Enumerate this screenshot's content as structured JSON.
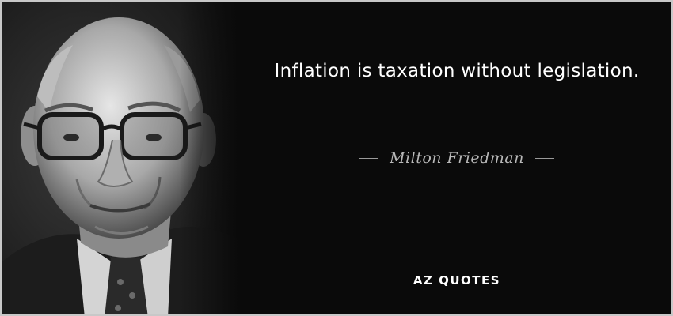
{
  "quote": {
    "text": "Inflation is taxation without legislation."
  },
  "author": {
    "name": "Milton Friedman"
  },
  "brand": {
    "label": "AZ QUOTES"
  },
  "colors": {
    "background": "#0a0a0a",
    "quote_text": "#ffffff",
    "author_text": "#b8b8b8",
    "border": "#c8c8c8"
  },
  "portrait": {
    "description_icon": "portrait-photo"
  }
}
